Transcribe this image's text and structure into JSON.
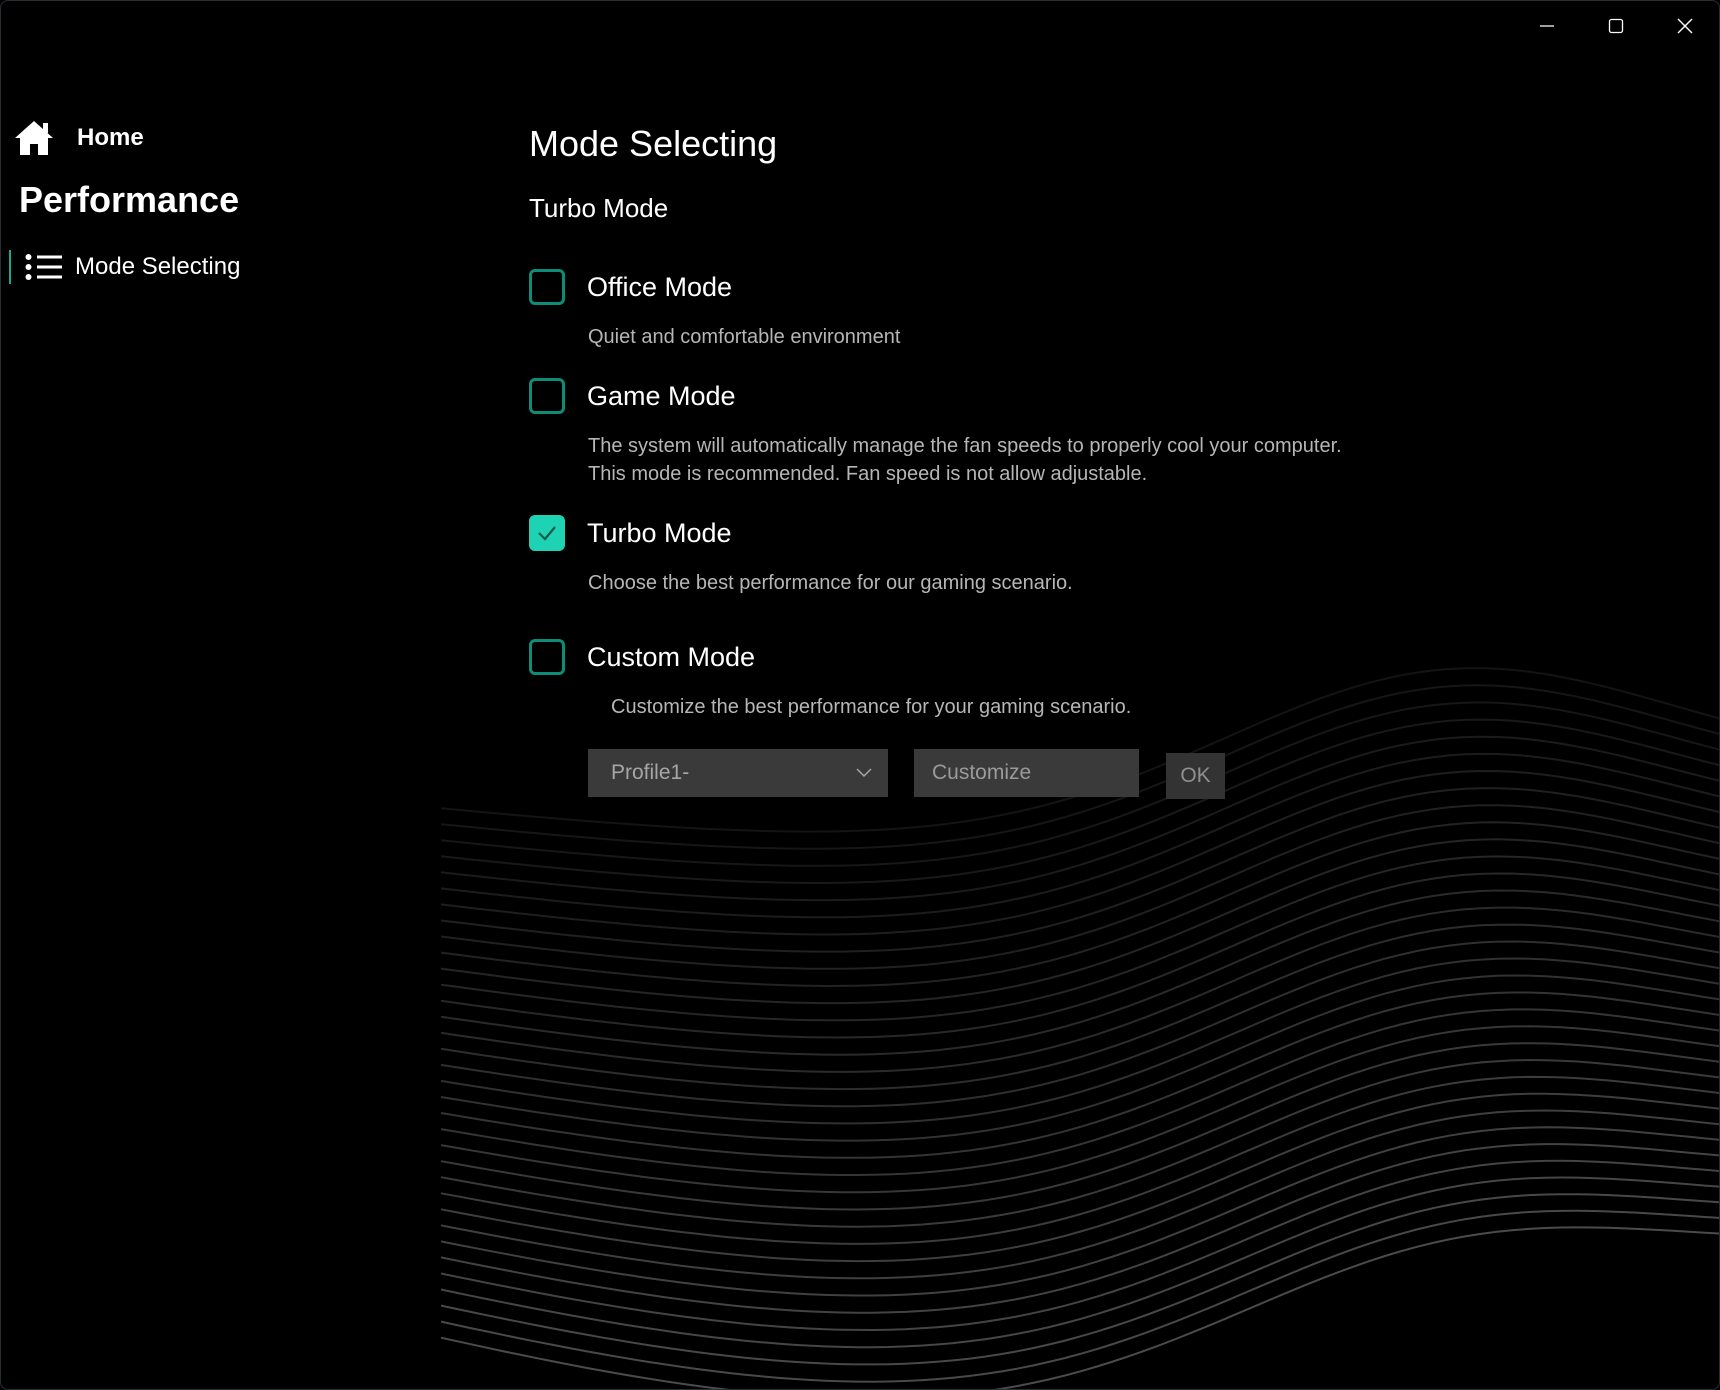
{
  "window": {
    "minimize_icon": "minimize-icon",
    "maximize_icon": "maximize-icon",
    "close_icon": "close-icon"
  },
  "sidebar": {
    "home_label": "Home",
    "section_title": "Performance",
    "nav_items": [
      {
        "label": "Mode Selecting",
        "icon": "list-icon",
        "selected": true
      }
    ]
  },
  "main": {
    "title": "Mode Selecting",
    "current_mode": "Turbo Mode",
    "modes": [
      {
        "label": "Office Mode",
        "checked": false,
        "description": [
          "Quiet and comfortable environment"
        ]
      },
      {
        "label": "Game Mode",
        "checked": false,
        "description": [
          "The system will automatically manage the fan speeds to properly cool your computer.",
          "This mode is recommended. Fan speed is not allow adjustable."
        ]
      },
      {
        "label": "Turbo Mode",
        "checked": true,
        "description": [
          "Choose the best performance for our gaming scenario."
        ]
      },
      {
        "label": "Custom Mode",
        "checked": false,
        "description": [
          "Customize the best performance for your gaming scenario."
        ]
      }
    ],
    "profile_select": {
      "value": "Profile1-"
    },
    "customize_input": {
      "placeholder": "Customize"
    },
    "ok_label": "OK"
  },
  "colors": {
    "accent": "#1ed3b3",
    "checkbox_border": "#0f8c78",
    "background": "#000000",
    "control_bg": "#3a3a3a"
  }
}
